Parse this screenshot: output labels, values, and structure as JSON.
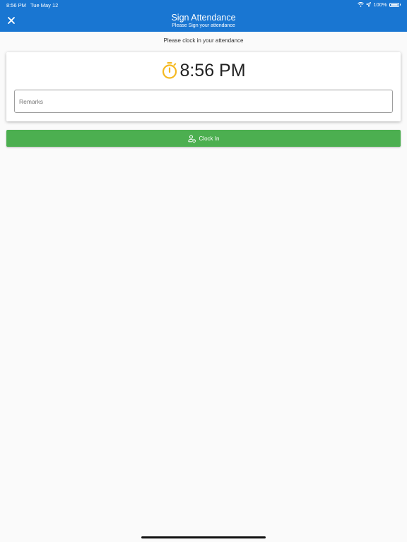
{
  "status_bar": {
    "time": "8:56 PM",
    "date": "Tue May 12",
    "battery": "100%",
    "icons": [
      "wifi-icon",
      "location-arrow-icon",
      "battery-icon"
    ]
  },
  "header": {
    "title": "Sign Attendance",
    "subtitle": "Please Sign your attendance",
    "close_icon": "close-icon",
    "background": "#1976d2"
  },
  "instruction": "Please clock in your attendance",
  "clock": {
    "icon": "stopwatch-icon",
    "icon_color": "#f5b921",
    "time": "8:56 PM"
  },
  "remarks": {
    "placeholder": "Remarks",
    "value": ""
  },
  "clock_in_button": {
    "label": "Clock In",
    "icon": "person-clock-icon",
    "color": "#4caf50"
  }
}
